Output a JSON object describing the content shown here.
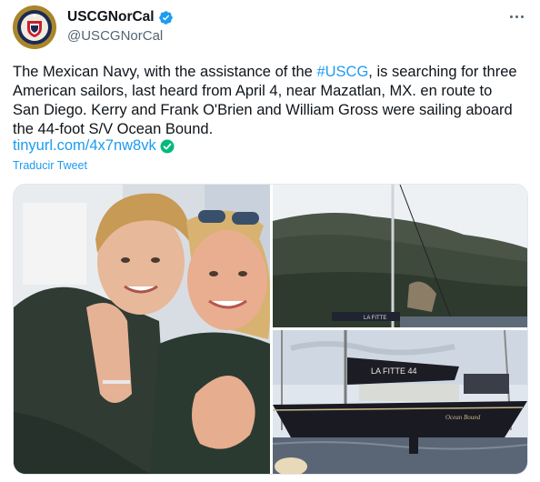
{
  "author": {
    "name": "USCGNorCal",
    "handle": "@USCGNorCal",
    "verified": true,
    "avatar_icon": "uscg-seal-icon"
  },
  "tweet": {
    "text_parts": [
      "The Mexican Navy, with the assistance of the ",
      "#USCG",
      ", is searching for three American sailors, last heard from April 4, near Mazatlan, MX. en route to San Diego. Kerry and Frank O'Brien and William Gross were sailing aboard the 44-foot S/V Ocean Bound."
    ],
    "link": "tinyurl.com/4x7nw8vk",
    "translate_label": "Traducir Tweet"
  },
  "media": {
    "boat_lettering": "LA FITTE 44",
    "hull_lettering": "Ocean Bound"
  },
  "colors": {
    "link": "#1d9bf0",
    "verified": "#1d9bf0",
    "link_check": "#00ba7c",
    "text": "#0f1419",
    "secondary": "#536471"
  }
}
